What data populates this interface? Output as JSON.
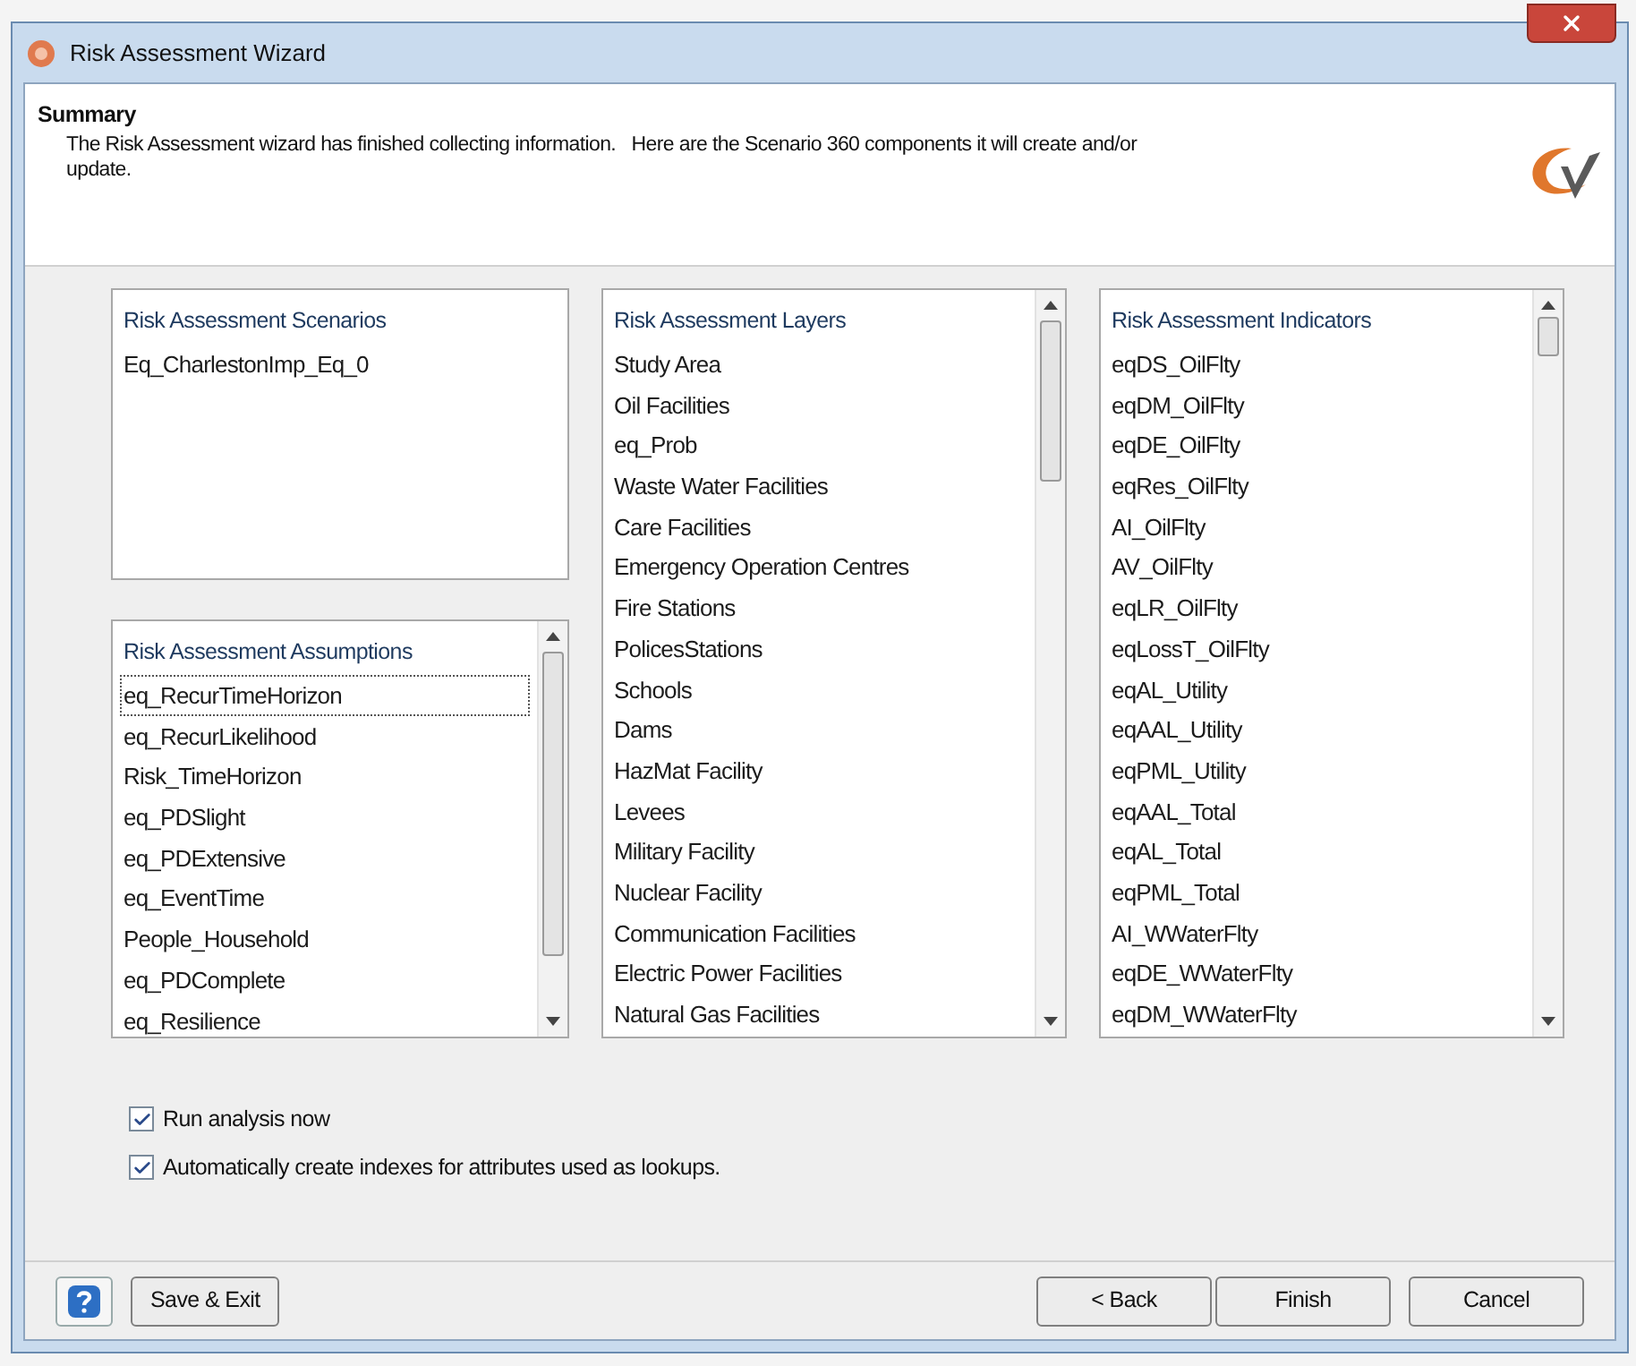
{
  "window": {
    "title": "Risk Assessment Wizard"
  },
  "header": {
    "title": "Summary",
    "text": "The Risk Assessment wizard has finished collecting information.   Here are the Scenario 360 components it will create and/or update."
  },
  "lists": [
    {
      "heading": "Risk Assessment Scenarios",
      "scrollbar": false,
      "items": [
        {
          "label": "Eq_CharlestonImp_Eq_0",
          "focused": false
        }
      ]
    },
    {
      "heading": "Risk Assessment Assumptions",
      "scrollbar": true,
      "items": [
        {
          "label": "eq_RecurTimeHorizon",
          "focused": true
        },
        {
          "label": "eq_RecurLikelihood",
          "focused": false
        },
        {
          "label": "Risk_TimeHorizon",
          "focused": false
        },
        {
          "label": "eq_PDSlight",
          "focused": false
        },
        {
          "label": "eq_PDExtensive",
          "focused": false
        },
        {
          "label": "eq_EventTime",
          "focused": false
        },
        {
          "label": "People_Household",
          "focused": false
        },
        {
          "label": "eq_PDComplete",
          "focused": false
        },
        {
          "label": "eq_Resilience",
          "focused": false
        }
      ]
    },
    {
      "heading": "Risk Assessment Layers",
      "scrollbar": true,
      "items": [
        {
          "label": "Study Area",
          "focused": false
        },
        {
          "label": "Oil Facilities",
          "focused": false
        },
        {
          "label": "eq_Prob",
          "focused": false
        },
        {
          "label": "Waste Water Facilities",
          "focused": false
        },
        {
          "label": "Care Facilities",
          "focused": false
        },
        {
          "label": "Emergency Operation Centres",
          "focused": false
        },
        {
          "label": "Fire Stations",
          "focused": false
        },
        {
          "label": "PolicesStations",
          "focused": false
        },
        {
          "label": "Schools",
          "focused": false
        },
        {
          "label": "Dams",
          "focused": false
        },
        {
          "label": "HazMat Facility",
          "focused": false
        },
        {
          "label": "Levees",
          "focused": false
        },
        {
          "label": "Military Facility",
          "focused": false
        },
        {
          "label": "Nuclear Facility",
          "focused": false
        },
        {
          "label": "Communication Facilities",
          "focused": false
        },
        {
          "label": "Electric Power Facilities",
          "focused": false
        },
        {
          "label": "Natural Gas Facilities",
          "focused": false
        }
      ]
    },
    {
      "heading": "Risk Assessment Indicators",
      "scrollbar": true,
      "items": [
        {
          "label": "eqDS_OilFlty",
          "focused": false
        },
        {
          "label": "eqDM_OilFlty",
          "focused": false
        },
        {
          "label": "eqDE_OilFlty",
          "focused": false
        },
        {
          "label": "eqRes_OilFlty",
          "focused": false
        },
        {
          "label": "AI_OilFlty",
          "focused": false
        },
        {
          "label": "AV_OilFlty",
          "focused": false
        },
        {
          "label": "eqLR_OilFlty",
          "focused": false
        },
        {
          "label": "eqLossT_OilFlty",
          "focused": false
        },
        {
          "label": "eqAL_Utility",
          "focused": false
        },
        {
          "label": "eqAAL_Utility",
          "focused": false
        },
        {
          "label": "eqPML_Utility",
          "focused": false
        },
        {
          "label": "eqAAL_Total",
          "focused": false
        },
        {
          "label": "eqAL_Total",
          "focused": false
        },
        {
          "label": "eqPML_Total",
          "focused": false
        },
        {
          "label": "AI_WWaterFlty",
          "focused": false
        },
        {
          "label": "eqDE_WWaterFlty",
          "focused": false
        },
        {
          "label": "eqDM_WWaterFlty",
          "focused": false
        }
      ]
    }
  ],
  "options": [
    {
      "label": "Run analysis now",
      "checked": true
    },
    {
      "label": "Automatically create indexes for attributes used as lookups.",
      "checked": true
    }
  ],
  "buttons": {
    "left": [
      "Save & Exit"
    ],
    "right": [
      "< Back",
      "Finish",
      "Cancel"
    ]
  }
}
